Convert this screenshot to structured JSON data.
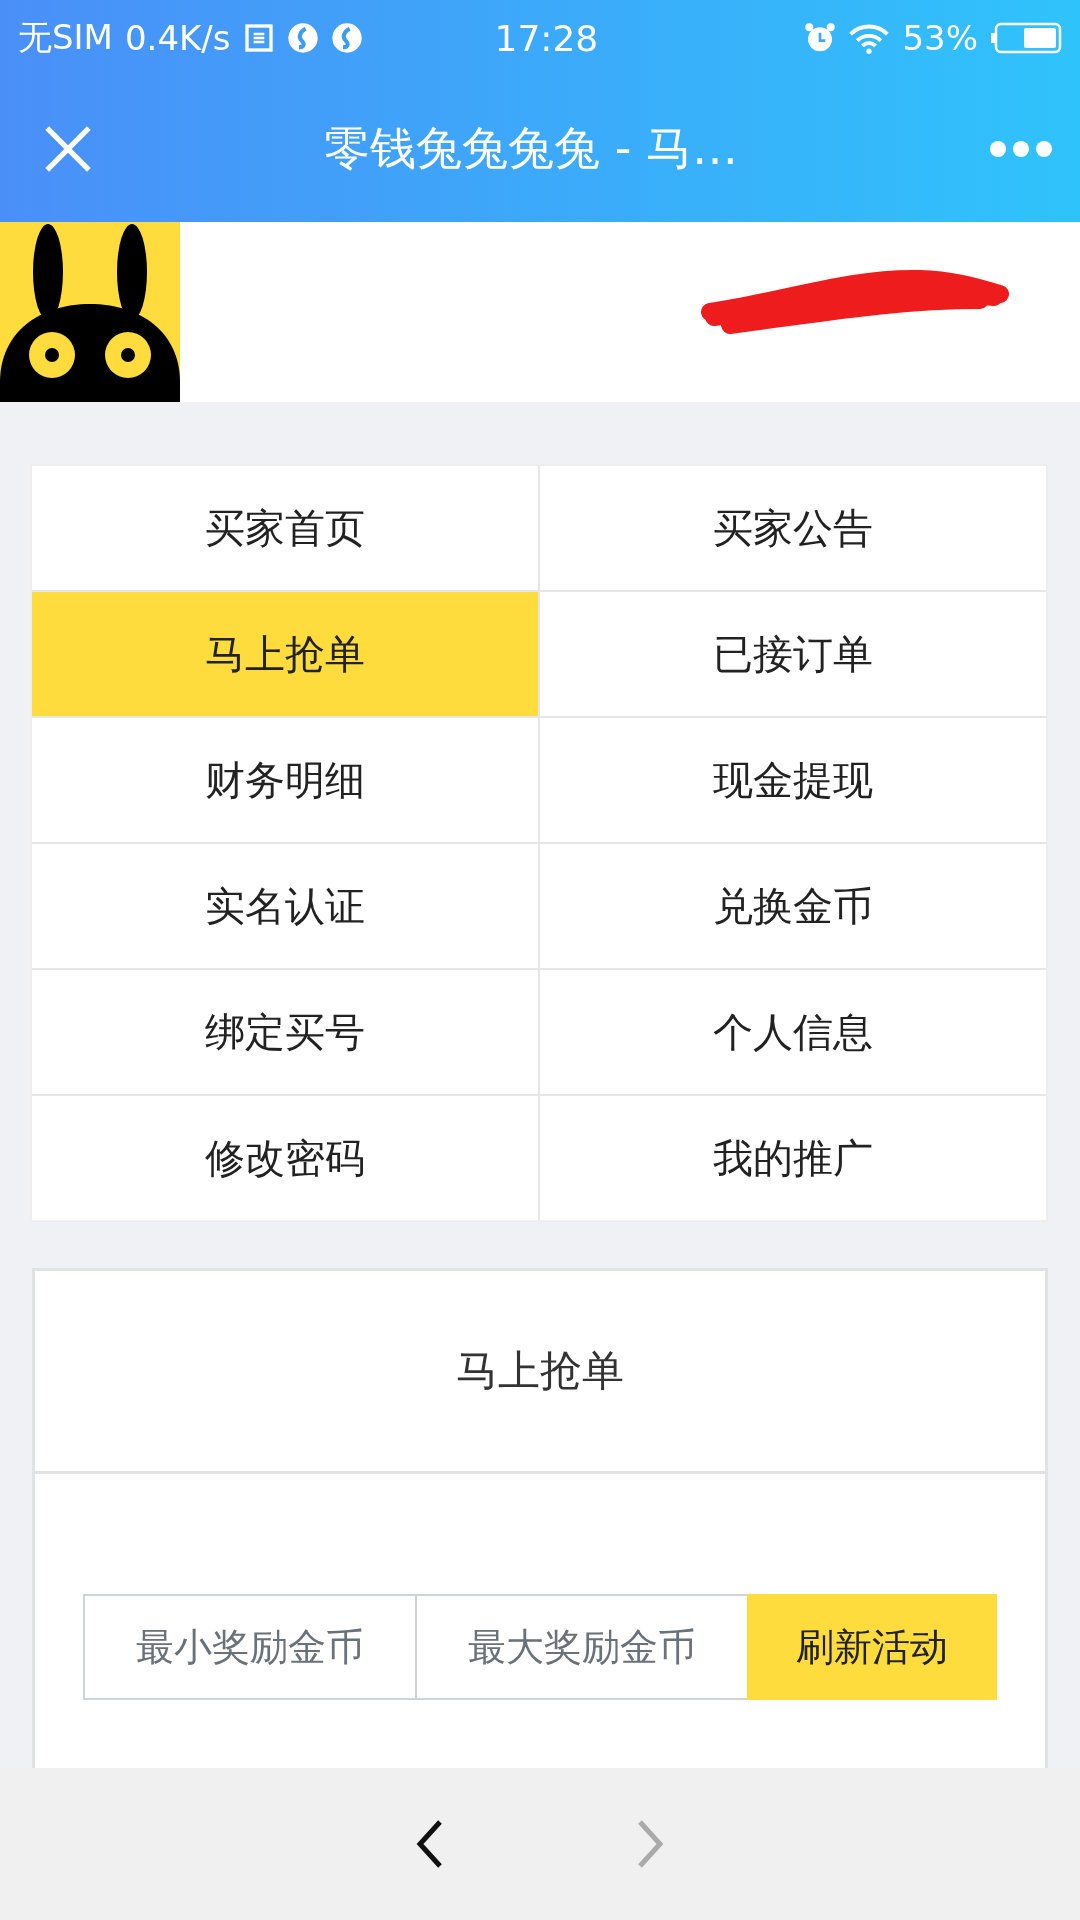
{
  "status_bar": {
    "carrier": "无SIM",
    "speed": "0.4K/s",
    "time": "17:28",
    "battery": "53%"
  },
  "header": {
    "title": "零钱兔兔兔兔 - 马…"
  },
  "menu": [
    {
      "label": "买家首页",
      "selected": false
    },
    {
      "label": "买家公告",
      "selected": false
    },
    {
      "label": "马上抢单",
      "selected": true
    },
    {
      "label": "已接订单",
      "selected": false
    },
    {
      "label": "财务明细",
      "selected": false
    },
    {
      "label": "现金提现",
      "selected": false
    },
    {
      "label": "实名认证",
      "selected": false
    },
    {
      "label": "兑换金币",
      "selected": false
    },
    {
      "label": "绑定买号",
      "selected": false
    },
    {
      "label": "个人信息",
      "selected": false
    },
    {
      "label": "修改密码",
      "selected": false
    },
    {
      "label": "我的推广",
      "selected": false
    }
  ],
  "panel": {
    "title": "马上抢单",
    "min_field": {
      "placeholder": "最小奖励金币"
    },
    "max_field": {
      "placeholder": "最大奖励金币"
    },
    "button": "刷新活动"
  },
  "nav": {
    "back_disabled": false,
    "forward_disabled": true
  }
}
